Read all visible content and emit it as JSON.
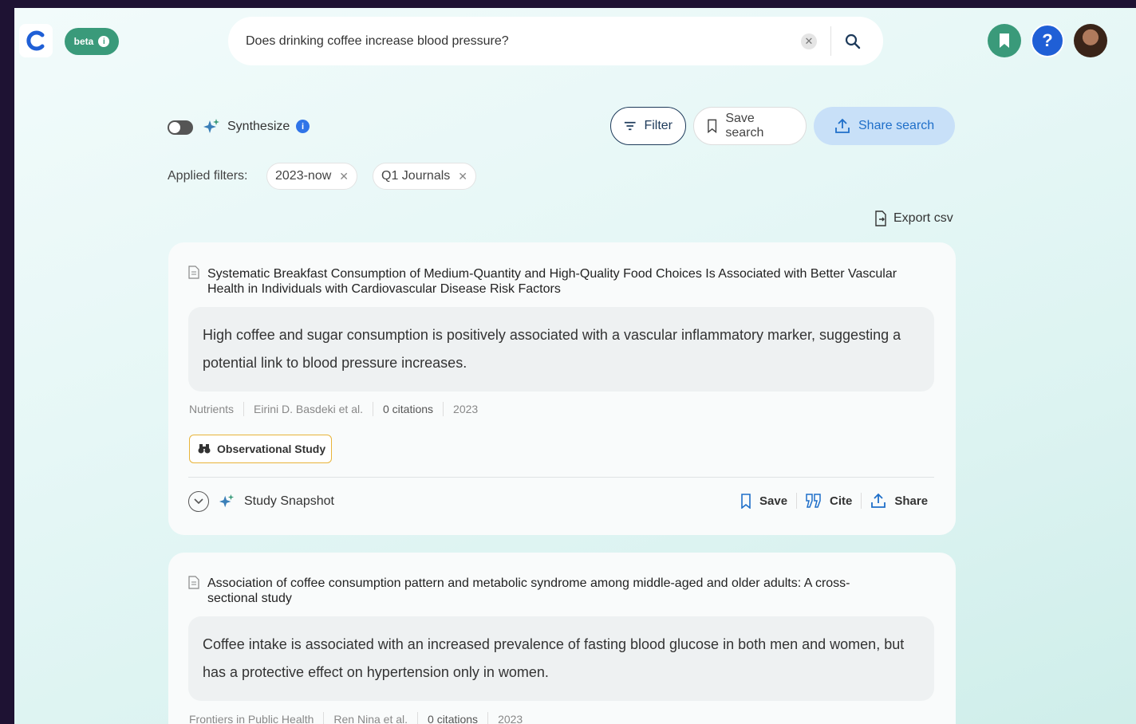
{
  "header": {
    "beta_label": "beta",
    "search": {
      "value": "Does drinking coffee increase blood pressure?",
      "placeholder": ""
    }
  },
  "toolbar": {
    "synthesize_label": "Synthesize",
    "filter_label": "Filter",
    "save_search_label": "Save search",
    "share_search_label": "Share search",
    "applied_filters_label": "Applied filters:",
    "filters": [
      "2023-now",
      "Q1 Journals"
    ],
    "export_label": "Export csv"
  },
  "results": [
    {
      "title": "Systematic Breakfast Consumption of Medium-Quantity and High-Quality Food Choices Is Associated with Better Vascular Health in Individuals with Cardiovascular Disease Risk Factors",
      "summary": "High coffee and sugar consumption is positively associated with a vascular inflammatory marker, suggesting a potential link to blood pressure increases.",
      "journal": "Nutrients",
      "authors": "Eirini D. Basdeki et al.",
      "citations": "0 citations",
      "year": "2023",
      "study_type": "Observational Study",
      "snapshot_label": "Study Snapshot",
      "save_label": "Save",
      "cite_label": "Cite",
      "share_label": "Share"
    },
    {
      "title": "Association of coffee consumption pattern and metabolic syndrome among middle-aged and older adults: A cross-sectional study",
      "summary": "Coffee intake is associated with an increased prevalence of fasting blood glucose in both men and women, but has a protective effect on hypertension only in women.",
      "journal": "Frontiers in Public Health",
      "authors": "Ren Nina et al.",
      "citations": "0 citations",
      "year": "2023"
    }
  ],
  "colors": {
    "brand_green": "#3a9a7a",
    "accent_blue": "#1f6fc9",
    "study_type_border": "#e8b43a"
  },
  "icons": [
    "consensus-logo-icon",
    "info-icon",
    "clear-icon",
    "search-icon",
    "bookmark-icon",
    "help-icon",
    "sparkle-icon",
    "filter-icon",
    "upload-icon",
    "export-icon",
    "paper-icon",
    "binoculars-icon",
    "chevron-down-icon",
    "quote-icon"
  ]
}
